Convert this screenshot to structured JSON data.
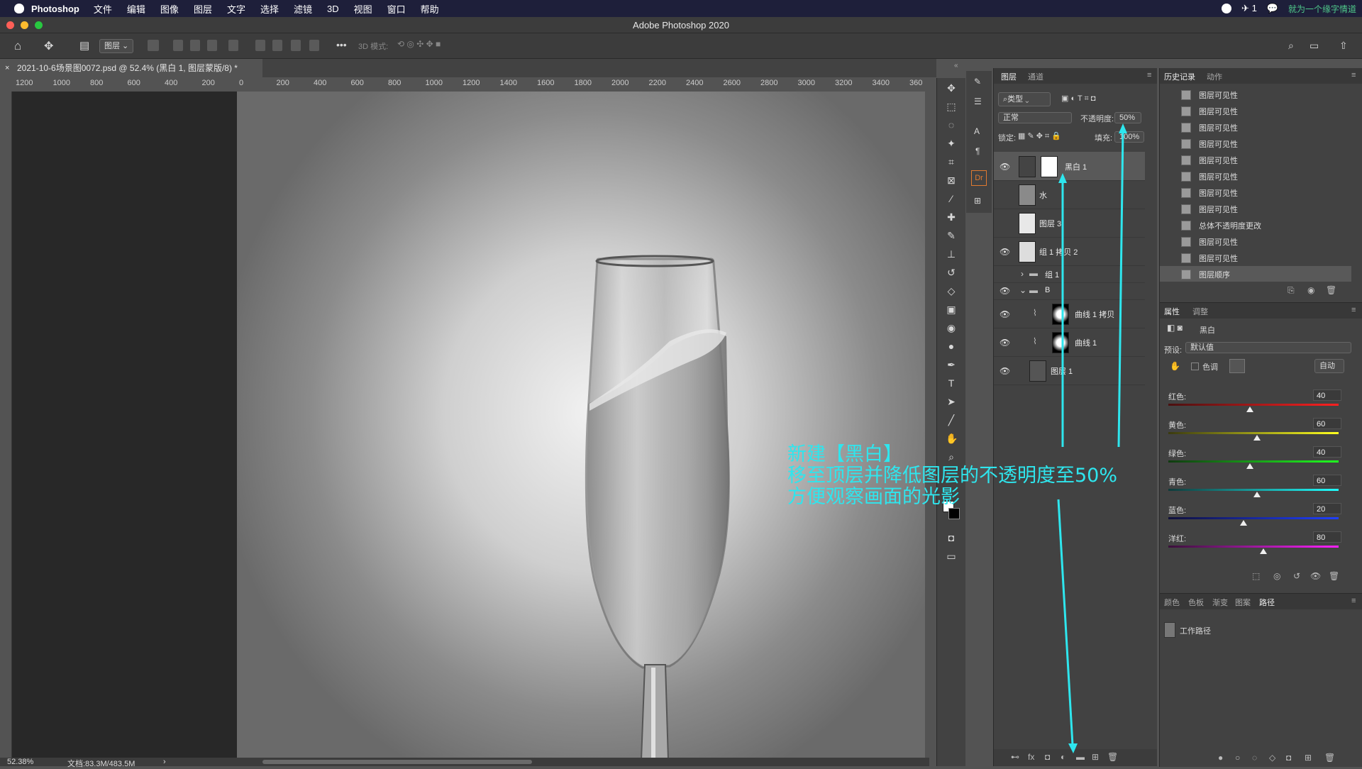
{
  "menubar": {
    "app_name": "Photoshop",
    "items": [
      "文件",
      "编辑",
      "图像",
      "图层",
      "文字",
      "选择",
      "滤镜",
      "3D",
      "视图",
      "窗口",
      "帮助"
    ],
    "badge_count": "1",
    "watermark": "就为一个缘字情道"
  },
  "window": {
    "title": "Adobe Photoshop 2020"
  },
  "options": {
    "layer_select": "图层",
    "mode_3d": "3D 模式:"
  },
  "document": {
    "tab_title": "2021-10-6场景图0072.psd @ 52.4% (黑白 1, 图层蒙版/8) *",
    "ruler_ticks": [
      "1200",
      "1000",
      "800",
      "600",
      "400",
      "200",
      "0",
      "200",
      "400",
      "600",
      "800",
      "1000",
      "1200",
      "1400",
      "1600",
      "1800",
      "2000",
      "2200",
      "2400",
      "2600",
      "2800",
      "3000",
      "3200",
      "3400",
      "360"
    ],
    "zoom": "52.38%",
    "doc_size": "文档:83.3M/483.5M"
  },
  "annotation": {
    "line1": "新建【黑白】",
    "line2": "移至顶层并降低图层的不透明度至50%",
    "line3": "方便观察画面的光影"
  },
  "layers_panel": {
    "tabs": [
      "图层",
      "通道"
    ],
    "filter_label": "类型",
    "blend_mode": "正常",
    "opacity_label": "不透明度:",
    "opacity_value": "50%",
    "lock_label": "锁定:",
    "fill_label": "填充:",
    "fill_value": "100%",
    "layers": [
      {
        "name": "黑白 1",
        "visible": true
      },
      {
        "name": "水",
        "visible": false
      },
      {
        "name": "图层 3",
        "visible": false
      },
      {
        "name": "组 1 拷贝 2",
        "visible": true
      },
      {
        "name": "组 1",
        "visible": false
      },
      {
        "name": "B",
        "visible": true
      },
      {
        "name": "曲线 1 拷贝",
        "visible": true
      },
      {
        "name": "曲线 1",
        "visible": true
      },
      {
        "name": "图层 1",
        "visible": true
      }
    ]
  },
  "history_panel": {
    "tabs": [
      "历史记录",
      "动作"
    ],
    "items": [
      "图层可见性",
      "图层可见性",
      "图层可见性",
      "图层可见性",
      "图层可见性",
      "图层可见性",
      "图层可见性",
      "图层可见性",
      "总体不透明度更改",
      "图层可见性",
      "图层可见性",
      "图层顺序"
    ]
  },
  "properties_panel": {
    "tabs": [
      "属性",
      "调整"
    ],
    "adjustment_name": "黑白",
    "preset_label": "预设:",
    "preset_value": "默认值",
    "tint_label": "色调",
    "auto_button": "自动",
    "sliders": [
      {
        "label": "红色:",
        "value": "40",
        "gradient": [
          "#4a1010",
          "#ff2020"
        ]
      },
      {
        "label": "黄色:",
        "value": "60",
        "gradient": [
          "#3a3a10",
          "#ffff20"
        ]
      },
      {
        "label": "绿色:",
        "value": "40",
        "gradient": [
          "#103a10",
          "#20ff20"
        ]
      },
      {
        "label": "青色:",
        "value": "60",
        "gradient": [
          "#103a3a",
          "#20ffff"
        ]
      },
      {
        "label": "蓝色:",
        "value": "20",
        "gradient": [
          "#10103a",
          "#2040ff"
        ]
      },
      {
        "label": "洋红:",
        "value": "80",
        "gradient": [
          "#3a103a",
          "#ff20ff"
        ]
      }
    ]
  },
  "paths_panel": {
    "tabs": [
      "颜色",
      "色板",
      "渐变",
      "图案",
      "路径"
    ],
    "items": [
      "工作路径"
    ]
  },
  "colors": {
    "annotation": "#2ee6ee",
    "panel_bg": "#424242",
    "canvas_dark": "#282828"
  }
}
